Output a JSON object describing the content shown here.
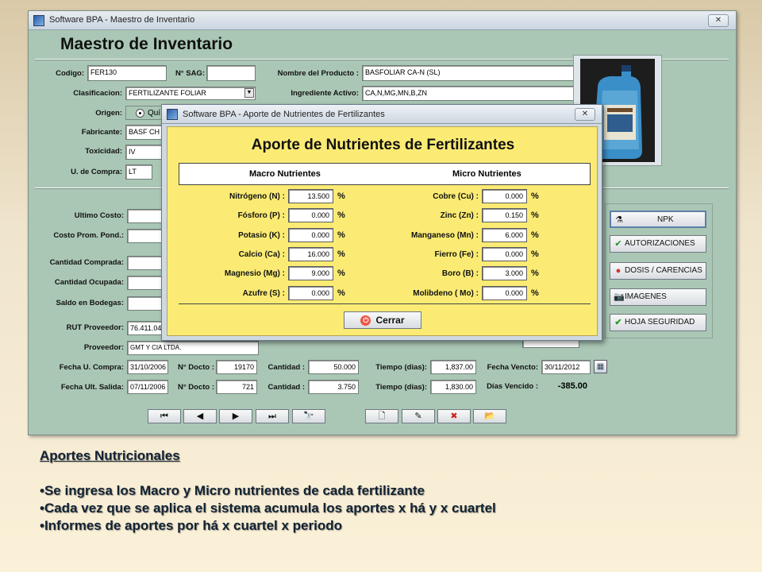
{
  "main_window": {
    "title": "Software BPA - Maestro de Inventario",
    "close_glyph": "✕",
    "heading": "Maestro de Inventario"
  },
  "form": {
    "codigo_label": "Codigo:",
    "codigo_value": "FER130",
    "nsag_label": "N° SAG:",
    "nsag_value": "",
    "nombre_label": "Nombre del Producto :",
    "nombre_value": "BASFOLIAR CA-N (SL)",
    "clasificacion_label": "Clasificacion:",
    "clasificacion_value": "FERTILIZANTE FOLIAR",
    "ingrediente_label": "Ingrediente Activo:",
    "ingrediente_value": "CA,N,MG,MN,B,ZN",
    "origen_label": "Origen:",
    "origen_option": "Quí",
    "fabricante_label": "Fabricante:",
    "fabricante_value": "BASF CH",
    "toxicidad_label": "Toxicidad:",
    "toxicidad_value": "IV",
    "ucompra_label": "U. de Compra:",
    "ucompra_value": "LT",
    "ultimo_costo_label": "Ultimo Costo:",
    "costo_prom_label": "Costo Prom. Pond.:",
    "cant_comprada_label": "Cantidad Comprada:",
    "cant_ocupada_label": "Cantidad Ocupada:",
    "saldo_label": "Saldo en Bodegas:",
    "rut_label": "RUT Proveedor:",
    "rut_value": "76.411.04",
    "proveedor_label": "Proveedor:",
    "proveedor_value": "GMT Y CIA LTDA.",
    "fecha_compra_label": "Fecha U. Compra:",
    "fecha_compra_value": "31/10/2006",
    "fecha_salida_label": "Fecha Ult. Salida:",
    "fecha_salida_value": "07/11/2006",
    "ndocto_label": "N° Docto :",
    "ndocto1_value": "19170",
    "ndocto2_value": "721",
    "cantidad_label": "Cantidad :",
    "cantidad1_value": "50.000",
    "cantidad2_value": "3.750",
    "tiempo_label": "Tiempo (dias):",
    "tiempo1_value": "1,837.00",
    "tiempo2_value": "1,830.00",
    "fecha_vencto_label": "Fecha Vencto:",
    "fecha_vencto_value": "30/11/2012",
    "dias_vencido_label": "Días Vencido :",
    "dias_vencido_value": "-385.00"
  },
  "side_buttons": {
    "npk": "NPK",
    "autorizaciones": "AUTORIZACIONES",
    "dosis": "DOSIS / CARENCIAS",
    "imagenes": "IMAGENES",
    "hoja": "HOJA SEGURIDAD"
  },
  "nav_icons": [
    "⏮",
    "◀",
    "▶",
    "⏭",
    "🔭",
    "🗋",
    "✎",
    "✖",
    "📂"
  ],
  "dialog": {
    "title": "Software BPA - Aporte de Nutrientes de Fertilizantes",
    "close_glyph": "✕",
    "heading": "Aporte de Nutrientes de Fertilizantes",
    "macro_header": "Macro Nutrientes",
    "micro_header": "Micro Nutrientes",
    "pct": "%",
    "macro": [
      {
        "label": "Nitrógeno (N) :",
        "value": "13.500"
      },
      {
        "label": "Fósforo (P) :",
        "value": "0.000"
      },
      {
        "label": "Potasio (K) :",
        "value": "0.000"
      },
      {
        "label": "Calcio (Ca) :",
        "value": "16.000"
      },
      {
        "label": "Magnesio (Mg) :",
        "value": "9.000"
      },
      {
        "label": "Azufre (S) :",
        "value": "0.000"
      }
    ],
    "micro": [
      {
        "label": "Cobre (Cu) :",
        "value": "0.000"
      },
      {
        "label": "Zinc (Zn) :",
        "value": "0.150"
      },
      {
        "label": "Manganeso (Mn) :",
        "value": "6.000"
      },
      {
        "label": "Fierro (Fe) :",
        "value": "0.000"
      },
      {
        "label": "Boro (B) :",
        "value": "3.000"
      },
      {
        "label": "Molibdeno ( Mo) :",
        "value": "0.000"
      }
    ],
    "close_button": "Cerrar"
  },
  "notes": {
    "heading": "Aportes Nutricionales",
    "bullets": [
      "•Se ingresa los Macro y Micro nutrientes de cada fertilizante",
      "•Cada vez que se aplica el sistema acumula los aportes x há y x cuartel",
      "•Informes de aportes por há x cuartel x periodo"
    ]
  },
  "colors": {
    "window_bg": "#aac7b5",
    "dialog_yellow": "#fbeb74",
    "notes_text": "#123344"
  }
}
